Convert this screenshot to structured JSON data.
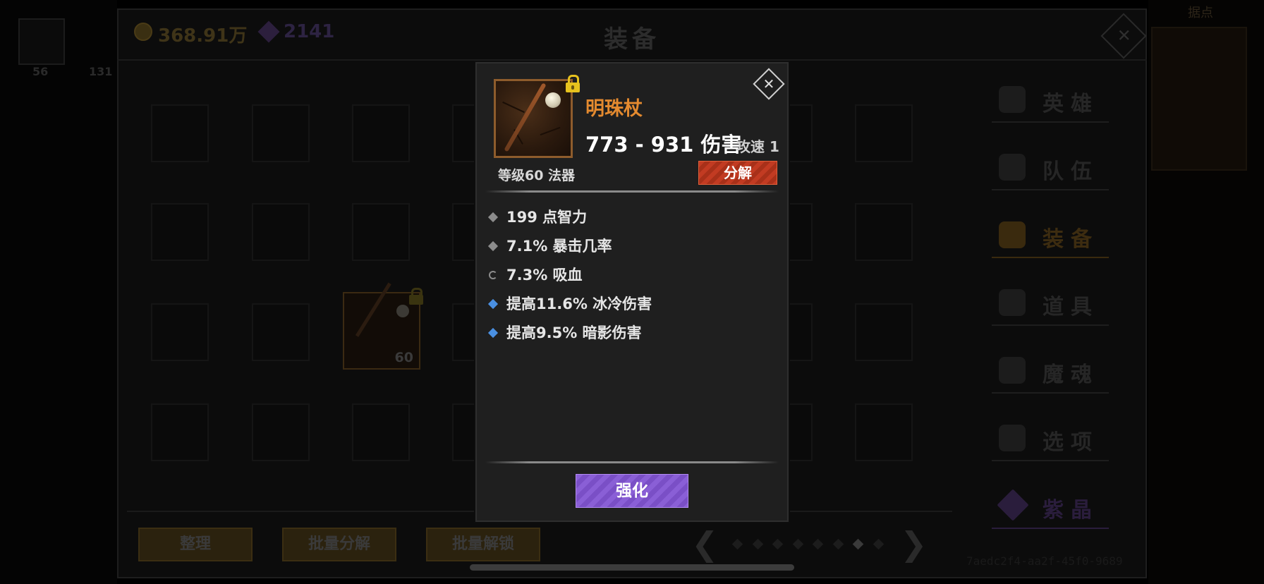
{
  "background": {
    "left_counts": [
      "56",
      "131"
    ],
    "right_label": "据点",
    "title": "装备",
    "currency": {
      "gold": "368.91万",
      "gems": "2141"
    },
    "item_level": "60",
    "buttons": {
      "sort": "整理",
      "batch_decompose": "批量分解",
      "batch_unlock": "批量解锁"
    },
    "pager": {
      "prev": "❮",
      "next": "❯",
      "total_pages": 8,
      "current_page": 7
    },
    "side_tabs": [
      "英雄",
      "队伍",
      "装备",
      "道具",
      "魔魂",
      "选项",
      "紫晶"
    ],
    "active_tab": "装备",
    "uuid": "7aedc2f4-aa2f-45f0-9689"
  },
  "modal": {
    "item_name": "明珠杖",
    "damage": "773 - 931 伤害",
    "attack_speed": "攻速 1",
    "level_type": "等级60 法器",
    "decompose_label": "分解",
    "close_symbol": "✕",
    "stats": [
      {
        "text": "199 点智力",
        "bullet": "gray"
      },
      {
        "text": "7.1% 暴击几率",
        "bullet": "gray"
      },
      {
        "text": "7.3% 吸血",
        "bullet": "cycle"
      },
      {
        "text": "提高11.6% 冰冷伤害",
        "bullet": "blue"
      },
      {
        "text": "提高9.5% 暗影伤害",
        "bullet": "blue"
      }
    ],
    "enhance_label": "强化",
    "colors": {
      "name": "#e48a2f",
      "decompose": "#c23b22",
      "enhance": "#8a5fd6",
      "magic_bullet": "#4a90e2"
    },
    "locked": true
  }
}
